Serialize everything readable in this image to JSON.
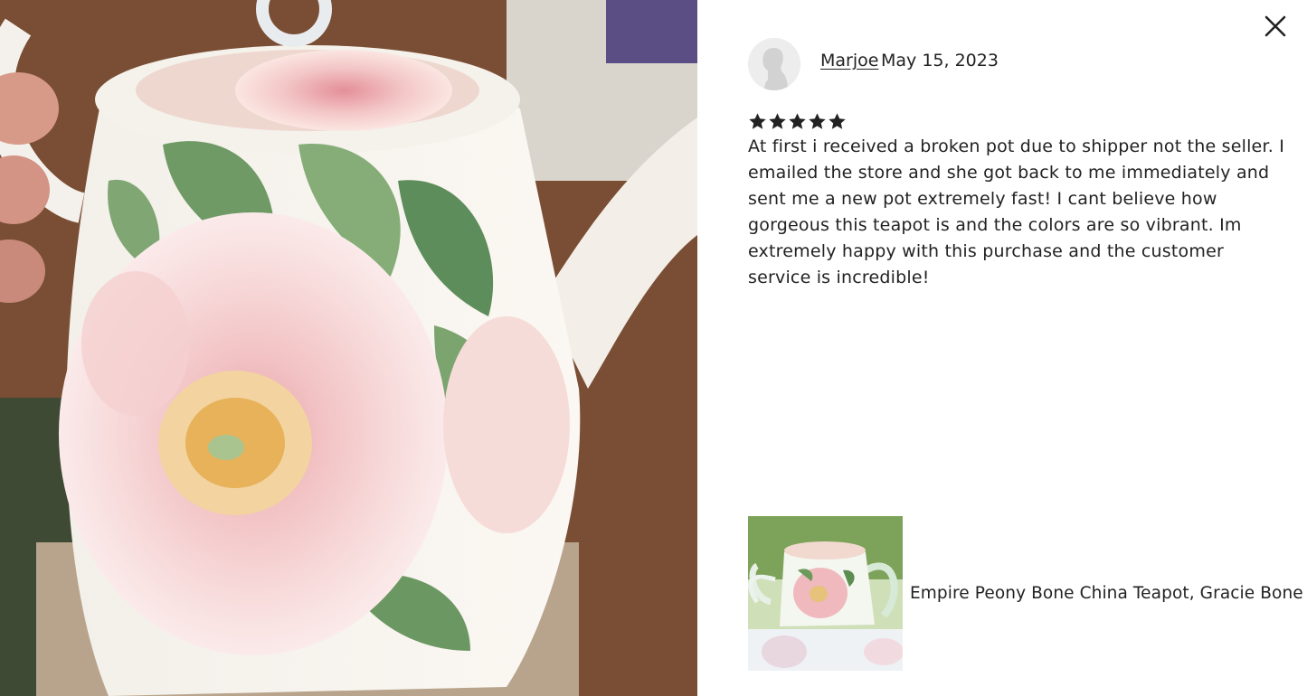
{
  "review": {
    "reviewer_name": "Marjoe",
    "date": "May 15, 2023",
    "rating": 5,
    "rating_max": 5,
    "text": "At first i received a broken pot due to shipper not the seller. I emailed the store and she got back to me immediately and sent me a new pot extremely fast! I cant believe how gorgeous this teapot is and the colors are so vibrant. Im extremely happy with this purchase and the customer service is incredible!"
  },
  "product": {
    "title": "Empire Peony Bone China Teapot, Gracie Bone China"
  },
  "icons": {
    "close": "close-icon",
    "star": "star-icon",
    "avatar": "default-avatar-icon"
  },
  "colors": {
    "text": "#222222",
    "star": "#222222",
    "background": "#ffffff",
    "avatar_bg": "#ededed"
  }
}
